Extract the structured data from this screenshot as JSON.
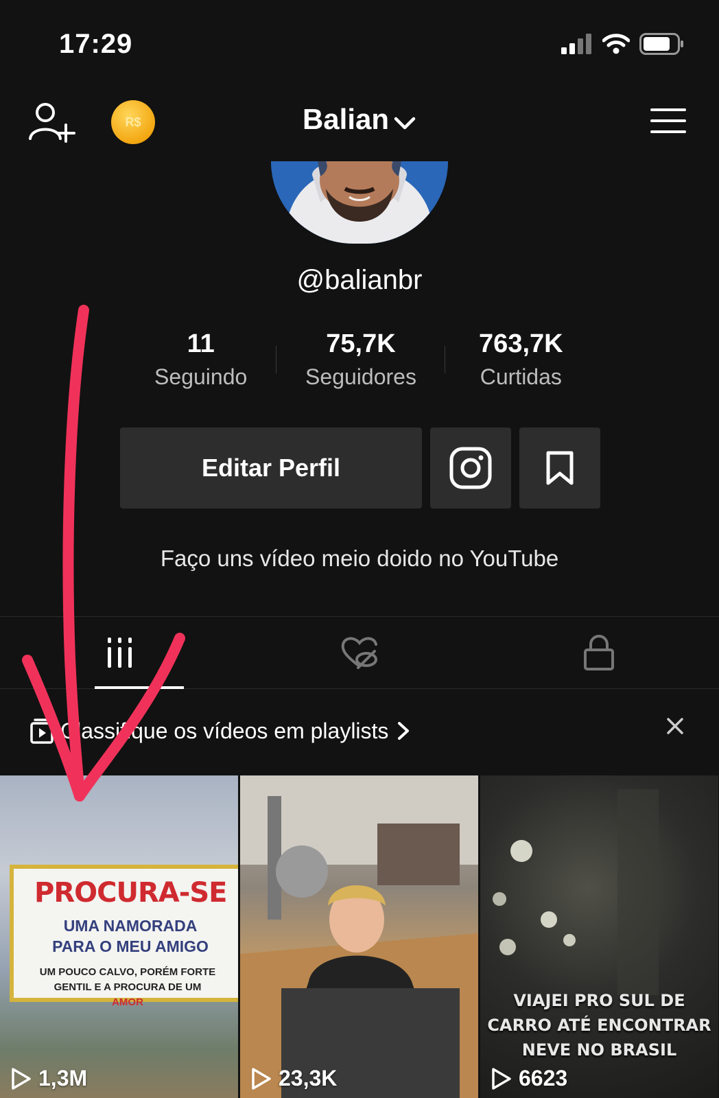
{
  "status": {
    "time": "17:29"
  },
  "header": {
    "account_name": "Balian",
    "coin_label": "R$"
  },
  "profile": {
    "handle": "@balianbr",
    "bio": "Faço uns vídeo meio doido no YouTube"
  },
  "stats": [
    {
      "value": "11",
      "label": "Seguindo"
    },
    {
      "value": "75,7K",
      "label": "Seguidores"
    },
    {
      "value": "763,7K",
      "label": "Curtidas"
    }
  ],
  "actions": {
    "edit_label": "Editar Perfil"
  },
  "playlist_banner": {
    "text": "Classifique os vídeos em playlists",
    "close": "×"
  },
  "videos": [
    {
      "views": "1,3M",
      "billboard_title": "PROCURA-SE",
      "billboard_sub": "UMA NAMORADA PARA O MEU AMIGO",
      "billboard_small": "UM POUCO CALVO, PORÉM FORTE GENTIL E A PROCURA DE UM",
      "billboard_red": "AMOR"
    },
    {
      "views": "23,3K"
    },
    {
      "views": "6623",
      "caption": "VIAJEI PRO SUL DE CARRO ATÉ ENCONTRAR NEVE NO BRASIL"
    }
  ],
  "colors": {
    "background": "#121212",
    "button": "#2d2d2d",
    "annotation_arrow": "#f0325a",
    "coin": "#f3a712"
  }
}
